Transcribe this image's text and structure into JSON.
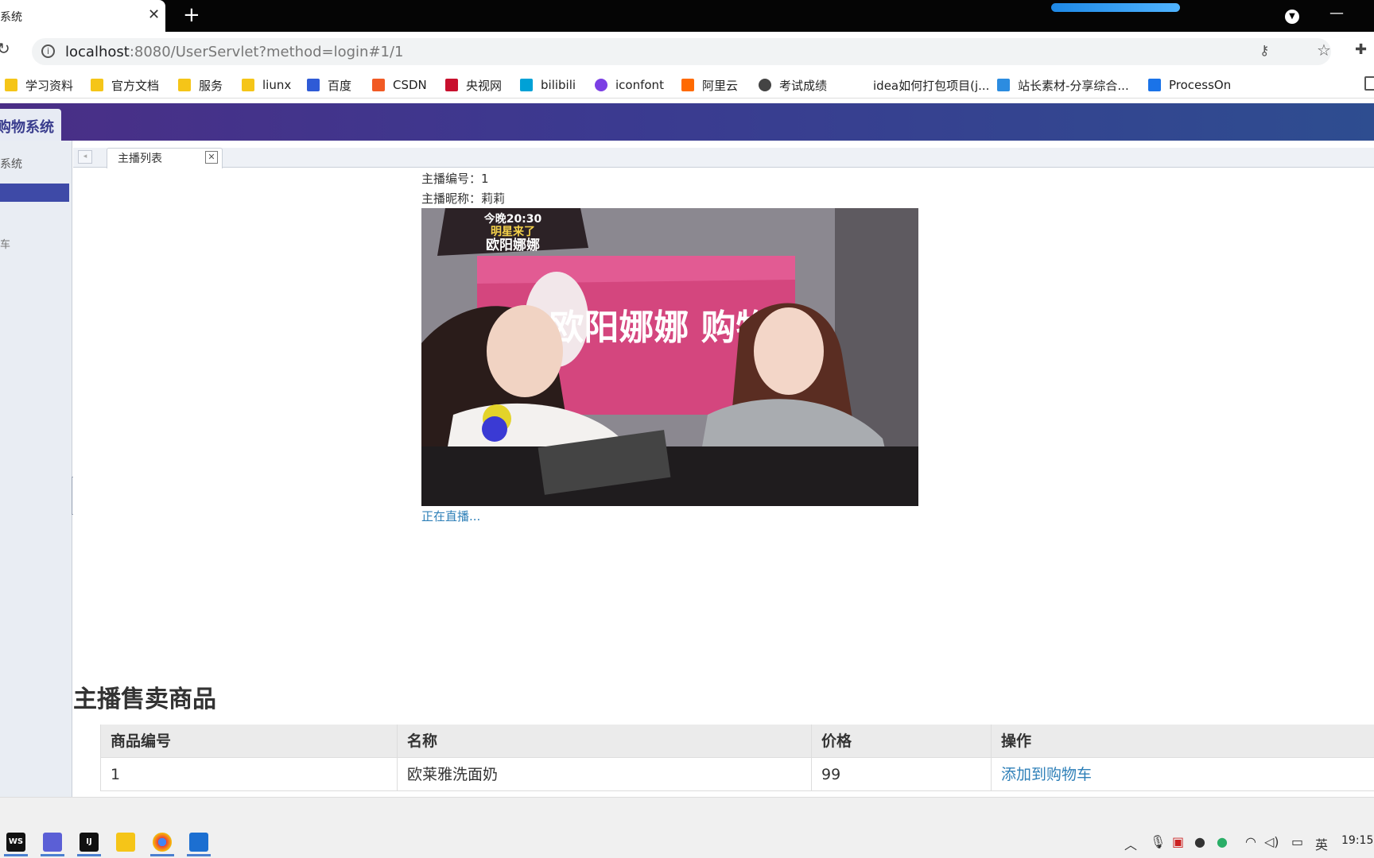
{
  "browser": {
    "tab_title": "系统",
    "tab_close": "✕",
    "new_tab": "+",
    "url_host": "localhost",
    "url_path": ":8080/UserServlet?method=login#1/1",
    "bookmarks": [
      {
        "label": "学习资料",
        "icon": "folder-icon"
      },
      {
        "label": "官方文档",
        "icon": "folder-icon"
      },
      {
        "label": "服务",
        "icon": "folder-icon"
      },
      {
        "label": "liunx",
        "icon": "folder-icon"
      },
      {
        "label": "百度",
        "icon": "baidu-icon"
      },
      {
        "label": "CSDN",
        "icon": "csdn-icon"
      },
      {
        "label": "央视网",
        "icon": "cctv-icon"
      },
      {
        "label": "bilibili",
        "icon": "bilibili-icon"
      },
      {
        "label": "iconfont",
        "icon": "iconfont-icon"
      },
      {
        "label": "阿里云",
        "icon": "aliyun-icon"
      },
      {
        "label": "考试成绩",
        "icon": "globe-icon"
      },
      {
        "label": "idea如何打包项目(j...",
        "icon": "blank-icon"
      },
      {
        "label": "站长素材-分享综合...",
        "icon": "chinaz-icon"
      },
      {
        "label": "ProcessOn",
        "icon": "processon-icon"
      }
    ]
  },
  "app": {
    "brand": "购物系统",
    "sidebar_title": "系统",
    "sidebar_item": "车",
    "content_tab": "主播列表",
    "content_tab_close": "✕"
  },
  "anchor": {
    "id_label": "主播编号：1",
    "nick_label": "主播昵称：莉莉",
    "live_link": "正在直播...",
    "image_overlay_1": "今晚20:30",
    "image_overlay_2": "明星来了",
    "image_overlay_3": "欧阳娜娜",
    "image_banner": "欧阳娜娜 购物"
  },
  "products": {
    "title": "主播售卖商品",
    "columns": [
      "商品编号",
      "名称",
      "价格",
      "操作"
    ],
    "rows": [
      {
        "id": "1",
        "name": "欧莱雅洗面奶",
        "price": "99",
        "action": "添加到购物车"
      }
    ]
  },
  "taskbar": {
    "apps": [
      "WS",
      "",
      "IJ",
      "",
      "",
      ""
    ],
    "ime": "英",
    "clock": "19:15"
  },
  "colors": {
    "header_gradient_start": "#4a2e86",
    "header_gradient_end": "#2e4d90",
    "link": "#2f80b8",
    "sidebar_active": "#3e4aa7"
  }
}
